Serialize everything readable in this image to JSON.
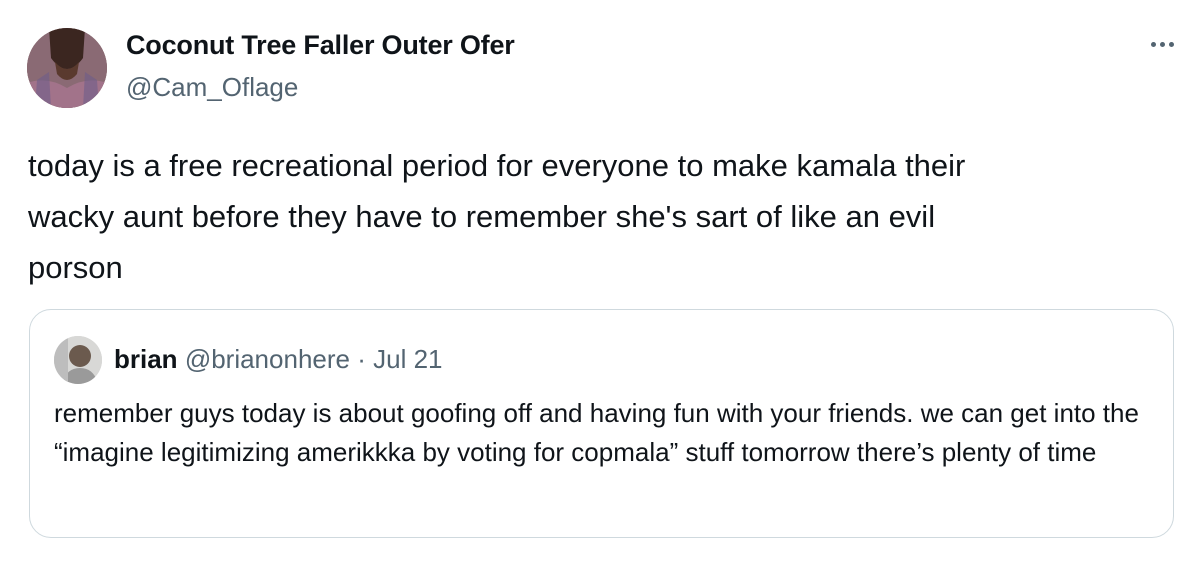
{
  "author": {
    "name": "Coconut Tree Faller Outer Ofer",
    "handle": "@Cam_Oflage"
  },
  "post": {
    "text": "today is a free recreational period for everyone to make kamala their\nwacky aunt before they have to remember she's sart of like an evil\nporson"
  },
  "more_menu": {
    "icon": "more-horizontal-icon"
  },
  "quoted_post": {
    "name": "brian",
    "handle": "@brianonhere",
    "separator": "·",
    "date": "Jul 21",
    "text": "remember guys today is about goofing off and having fun with your friends. we can get into the “imagine legitimizing amerikkka by voting for copmala” stuff tomorrow there’s plenty of time"
  },
  "colors": {
    "primary_text": "#0f1419",
    "secondary_text": "#536471",
    "border": "#cfd9de",
    "background": "#ffffff"
  }
}
